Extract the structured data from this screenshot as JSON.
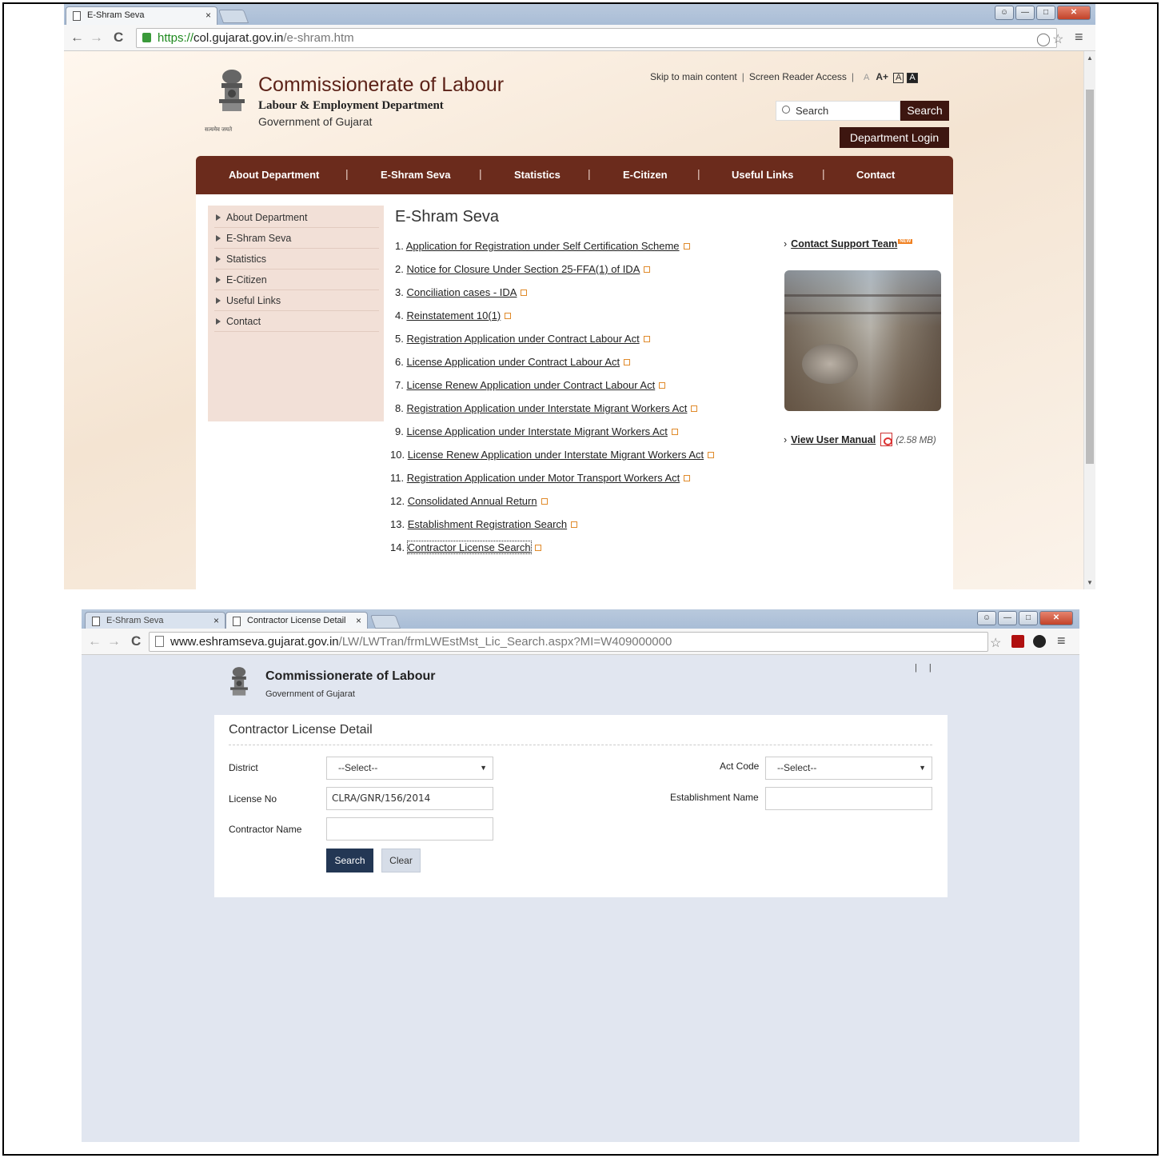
{
  "window1": {
    "tab_title": "E-Shram Seva",
    "tab_close": "×",
    "url": {
      "scheme": "https://",
      "host": "col.gujarat.gov.in",
      "path": "/e-shram.htm"
    },
    "page": {
      "org_title": "Commissionerate of Labour",
      "org_subtitle": "Labour & Employment Department",
      "org_gov": "Government of Gujarat",
      "emblem_motto": "सत्यमेव जयते",
      "skip_link": "Skip to main content",
      "screen_reader": "Screen Reader Access",
      "link_sep": "|",
      "font_small": "A",
      "font_large": "A+",
      "contrast_light": "A",
      "contrast_dark": "A",
      "search_placeholder": "Search",
      "search_button": "Search",
      "login_button": "Department Login",
      "nav": [
        "About Department",
        "E-Shram Seva",
        "Statistics",
        "E-Citizen",
        "Useful Links",
        "Contact"
      ],
      "sidebar": [
        "About Department",
        "E-Shram Seva",
        "Statistics",
        "E-Citizen",
        "Useful Links",
        "Contact"
      ],
      "heading": "E-Shram Seva",
      "links": [
        {
          "num": "1.",
          "text": "Application for Registration under Self Certification Scheme"
        },
        {
          "num": "2.",
          "text": "Notice for Closure Under Section 25-FFA(1) of IDA"
        },
        {
          "num": "3.",
          "text": "Conciliation cases - IDA"
        },
        {
          "num": "4.",
          "text": "Reinstatement 10(1)"
        },
        {
          "num": "5.",
          "text": "Registration Application under Contract Labour Act"
        },
        {
          "num": "6.",
          "text": "License Application under Contract Labour Act"
        },
        {
          "num": "7.",
          "text": "License Renew Application under Contract Labour Act"
        },
        {
          "num": "8.",
          "text": "Registration Application under Interstate Migrant Workers Act"
        },
        {
          "num": "9.",
          "text": "License Application under Interstate Migrant Workers Act"
        },
        {
          "num": "10.",
          "text": "License Renew Application under Interstate Migrant Workers Act"
        },
        {
          "num": "11.",
          "text": "Registration Application under Motor Transport Workers Act"
        },
        {
          "num": "12.",
          "text": "Consolidated Annual Return"
        },
        {
          "num": "13.",
          "text": "Establishment Registration Search"
        },
        {
          "num": "14.",
          "text": "Contractor License Search"
        }
      ],
      "support_link": "Contact Support Team",
      "new_badge": "NEW",
      "manual_link": "View User Manual",
      "manual_size": "(2.58 MB)"
    }
  },
  "window2": {
    "tab1_title": "E-Shram Seva",
    "tab2_title": "Contractor License Detail",
    "tab_close": "×",
    "url": {
      "host": "www.eshramseva.gujarat.gov.in",
      "path": "/LW/LWTran/frmLWEstMst_Lic_Search.aspx?MI=W409000000"
    },
    "page": {
      "org_title": "Commissionerate of Labour",
      "org_gov": "Government of Gujarat",
      "header_pipes": "| |",
      "form_title": "Contractor License Detail",
      "district_label": "District",
      "district_value": "--Select--",
      "act_code_label": "Act Code",
      "act_code_value": "--Select--",
      "license_label": "License No",
      "license_value": "CLRA/GNR/156/2014",
      "establishment_label": "Establishment Name",
      "establishment_value": "",
      "contractor_label": "Contractor Name",
      "contractor_value": "",
      "search_button": "Search",
      "clear_button": "Clear"
    }
  },
  "colors": {
    "brand_brown": "#6b2b1c",
    "dark_button": "#3d1610",
    "navy_button": "#233754",
    "page2_bg": "#e1e6f0"
  }
}
